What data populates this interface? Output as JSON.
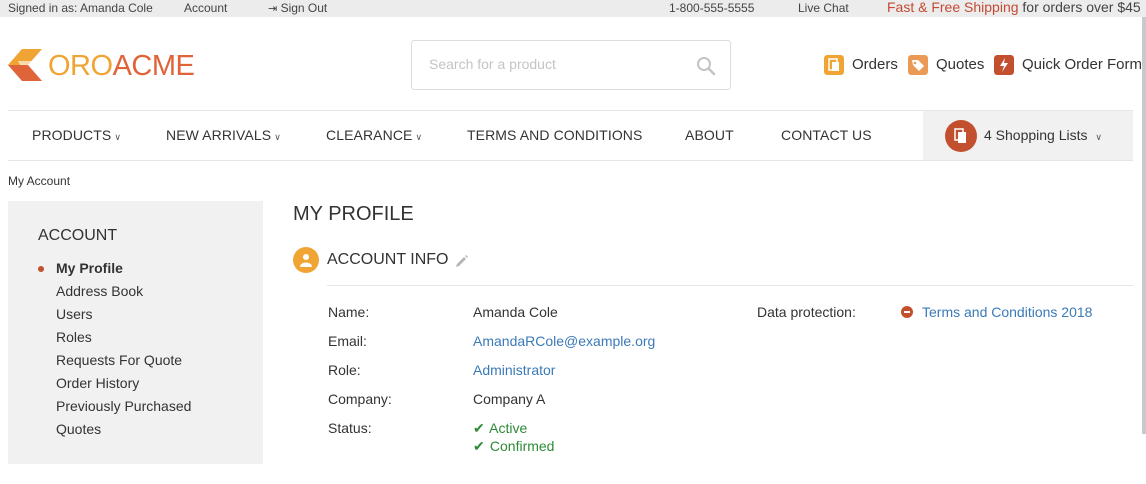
{
  "topbar": {
    "signed_in": "Signed in as: Amanda Cole",
    "account": "Account",
    "sign_out": "Sign Out",
    "phone": "1-800-555-5555",
    "live_chat": "Live Chat",
    "shipping_highlight": "Fast & Free Shipping",
    "shipping_rest": " for orders over $45"
  },
  "header": {
    "logo_part1": "ORO",
    "logo_part2": "ACME",
    "search_placeholder": "Search for a product",
    "links": {
      "orders": "Orders",
      "quotes": "Quotes",
      "quick_order": "Quick Order Form"
    }
  },
  "nav": {
    "products": "PRODUCTS",
    "new_arrivals": "NEW ARRIVALS",
    "clearance": "CLEARANCE",
    "terms": "TERMS AND CONDITIONS",
    "about": "ABOUT",
    "contact": "CONTACT US",
    "shopping_lists": "4 Shopping Lists"
  },
  "breadcrumb": "My Account",
  "sidebar": {
    "title": "ACCOUNT",
    "items": [
      "My Profile",
      "Address Book",
      "Users",
      "Roles",
      "Requests For Quote",
      "Order History",
      "Previously Purchased",
      "Quotes"
    ]
  },
  "main": {
    "page_title": "MY PROFILE",
    "section_title": "ACCOUNT INFO",
    "labels": {
      "name": "Name:",
      "email": "Email:",
      "role": "Role:",
      "company": "Company:",
      "status": "Status:",
      "data_protection": "Data protection:"
    },
    "values": {
      "name": "Amanda Cole",
      "email": "AmandaRCole@example.org",
      "role": "Administrator",
      "company": "Company A",
      "status_1": "Active",
      "status_2": "Confirmed",
      "data_protection": "Terms and Conditions 2018"
    }
  },
  "colors": {
    "accent_orange": "#f0a434",
    "accent_red": "#c2502e",
    "link_blue": "#3a7ab8",
    "success_green": "#2e8a36"
  }
}
